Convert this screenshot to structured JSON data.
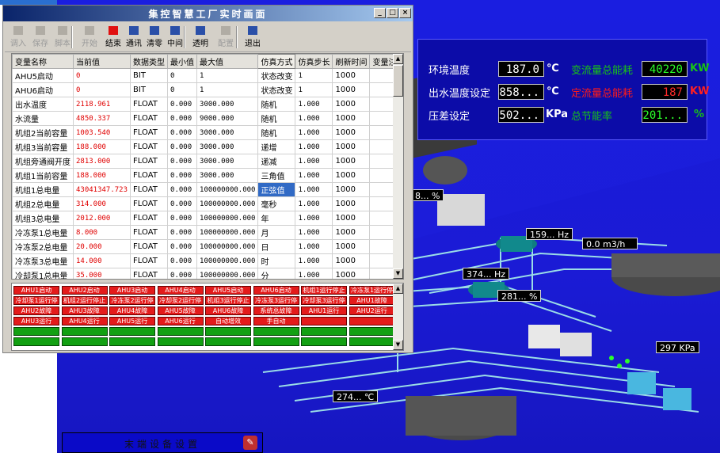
{
  "window": {
    "title": "集控智慧工厂实时画面",
    "controls": [
      "_",
      "□",
      "×"
    ]
  },
  "toolbar": [
    {
      "label": "调入",
      "enabled": false,
      "icon": "import-icon"
    },
    {
      "label": "保存",
      "enabled": false,
      "icon": "save-icon"
    },
    {
      "label": "脚本",
      "enabled": false,
      "icon": "script-icon"
    },
    {
      "label": "开始",
      "enabled": false,
      "icon": "start-icon"
    },
    {
      "label": "结束",
      "enabled": true,
      "icon": "stop-icon",
      "color": "#e01010"
    },
    {
      "label": "通讯",
      "enabled": true,
      "icon": "communication-icon"
    },
    {
      "label": "清零",
      "enabled": true,
      "icon": "clear-icon"
    },
    {
      "label": "中间",
      "enabled": true,
      "icon": "middle-icon"
    },
    {
      "label": "透明",
      "enabled": true,
      "icon": "transparent-icon"
    },
    {
      "label": "配置",
      "enabled": false,
      "icon": "config-icon"
    },
    {
      "label": "退出",
      "enabled": true,
      "icon": "exit-icon"
    }
  ],
  "grid": {
    "headers": [
      "变量名称",
      "当前值",
      "数据类型",
      "最小值",
      "最大值",
      "仿真方式",
      "仿真步长",
      "刷新时间",
      "变量注释"
    ],
    "rows": [
      [
        "AHU5启动",
        "0",
        "BIT",
        "0",
        "1",
        "状态改变",
        "1",
        "1000",
        ""
      ],
      [
        "AHU6启动",
        "0",
        "BIT",
        "0",
        "1",
        "状态改变",
        "1",
        "1000",
        ""
      ],
      [
        "出水温度",
        "2118.961",
        "FLOAT",
        "0.000",
        "3000.000",
        "随机",
        "1.000",
        "1000",
        ""
      ],
      [
        "水流量",
        "4850.337",
        "FLOAT",
        "0.000",
        "9000.000",
        "随机",
        "1.000",
        "1000",
        ""
      ],
      [
        "机组2当前容量",
        "1003.540",
        "FLOAT",
        "0.000",
        "3000.000",
        "随机",
        "1.000",
        "1000",
        ""
      ],
      [
        "机组3当前容量",
        "188.000",
        "FLOAT",
        "0.000",
        "3000.000",
        "递增",
        "1.000",
        "1000",
        ""
      ],
      [
        "机组旁通阀开度",
        "2813.000",
        "FLOAT",
        "0.000",
        "3000.000",
        "递减",
        "1.000",
        "1000",
        ""
      ],
      [
        "机组1当前容量",
        "188.000",
        "FLOAT",
        "0.000",
        "3000.000",
        "三角值",
        "1.000",
        "1000",
        ""
      ],
      [
        "机组1总电量",
        "43041347.723",
        "FLOAT",
        "0.000",
        "100000000.000",
        "正弦值",
        "1.000",
        "1000",
        ""
      ],
      [
        "机组2总电量",
        "314.000",
        "FLOAT",
        "0.000",
        "100000000.000",
        "毫秒",
        "1.000",
        "1000",
        ""
      ],
      [
        "机组3总电量",
        "2012.000",
        "FLOAT",
        "0.000",
        "100000000.000",
        "年",
        "1.000",
        "1000",
        ""
      ],
      [
        "冷冻泵1总电量",
        "8.000",
        "FLOAT",
        "0.000",
        "100000000.000",
        "月",
        "1.000",
        "1000",
        ""
      ],
      [
        "冷冻泵2总电量",
        "20.000",
        "FLOAT",
        "0.000",
        "100000000.000",
        "日",
        "1.000",
        "1000",
        ""
      ],
      [
        "冷冻泵3总电量",
        "14.000",
        "FLOAT",
        "0.000",
        "100000000.000",
        "时",
        "1.000",
        "1000",
        ""
      ],
      [
        "冷却泵1总电量",
        "35.000",
        "FLOAT",
        "0.000",
        "100000000.000",
        "分",
        "1.000",
        "1000",
        ""
      ]
    ],
    "selected_cell": {
      "row": 8,
      "col": 5
    }
  },
  "status_rows": [
    {
      "color": "red",
      "cells": [
        "AHU1启动",
        "AHU2启动",
        "AHU3启动",
        "AHU4启动",
        "AHU5启动",
        "AHU6启动",
        "机组1运行停止",
        "冷冻泵1运行停"
      ]
    },
    {
      "color": "red",
      "cells": [
        "冷却泵1运行停",
        "机组2运行停止",
        "冷冻泵2运行停",
        "冷却泵2运行停",
        "机组3运行停止",
        "冷冻泵3运行停",
        "冷却泵3运行停",
        "AHU1故障"
      ]
    },
    {
      "color": "red",
      "cells": [
        "AHU2故障",
        "AHU3故障",
        "AHU4故障",
        "AHU5故障",
        "AHU6故障",
        "系统总故障",
        "AHU1运行",
        "AHU2运行"
      ]
    },
    {
      "color": "red",
      "cells": [
        "AHU3运行",
        "AHU4运行",
        "AHU5运行",
        "AHU6运行",
        "自动增效",
        "手自动",
        "",
        ""
      ]
    },
    {
      "color": "green",
      "cells": [
        "",
        "",
        "",
        "",
        "",
        "",
        "",
        ""
      ]
    },
    {
      "color": "green",
      "cells": [
        "",
        "",
        "",
        "",
        "",
        "",
        "",
        ""
      ]
    }
  ],
  "info_panel": {
    "env_temp_label": "环境温度",
    "env_temp_value": "187.0",
    "env_temp_unit": "℃",
    "vflow_label": "变流量总能耗",
    "vflow_value": "40220",
    "vflow_unit": "KW",
    "outlet_temp_label": "出水温度设定",
    "outlet_temp_value": "858...",
    "outlet_temp_unit": "℃",
    "cflow_label": "定流量总能耗",
    "cflow_value": "187",
    "cflow_unit": "KW",
    "pressure_label": "压差设定",
    "pressure_value": "502...",
    "pressure_unit": "KPa",
    "saving_label": "总节能率",
    "saving_value": "201...",
    "saving_unit": "%"
  },
  "scene_tags": {
    "load_pct": "8... %",
    "pump_freq_1": "159... Hz",
    "flow_rate": "0.0  m3/h",
    "pump_freq_2": "374... Hz",
    "valve_pct": "281... %",
    "pressure": "297 KPa",
    "temperature": "274... ℃"
  },
  "bottom_button": {
    "label": "末端设备设置"
  },
  "colors": {
    "scene_blue": "#1a1ee0",
    "pipe": "#9ff0e8",
    "alarm_red": "#e41b1b",
    "ok_green": "#12a012"
  }
}
